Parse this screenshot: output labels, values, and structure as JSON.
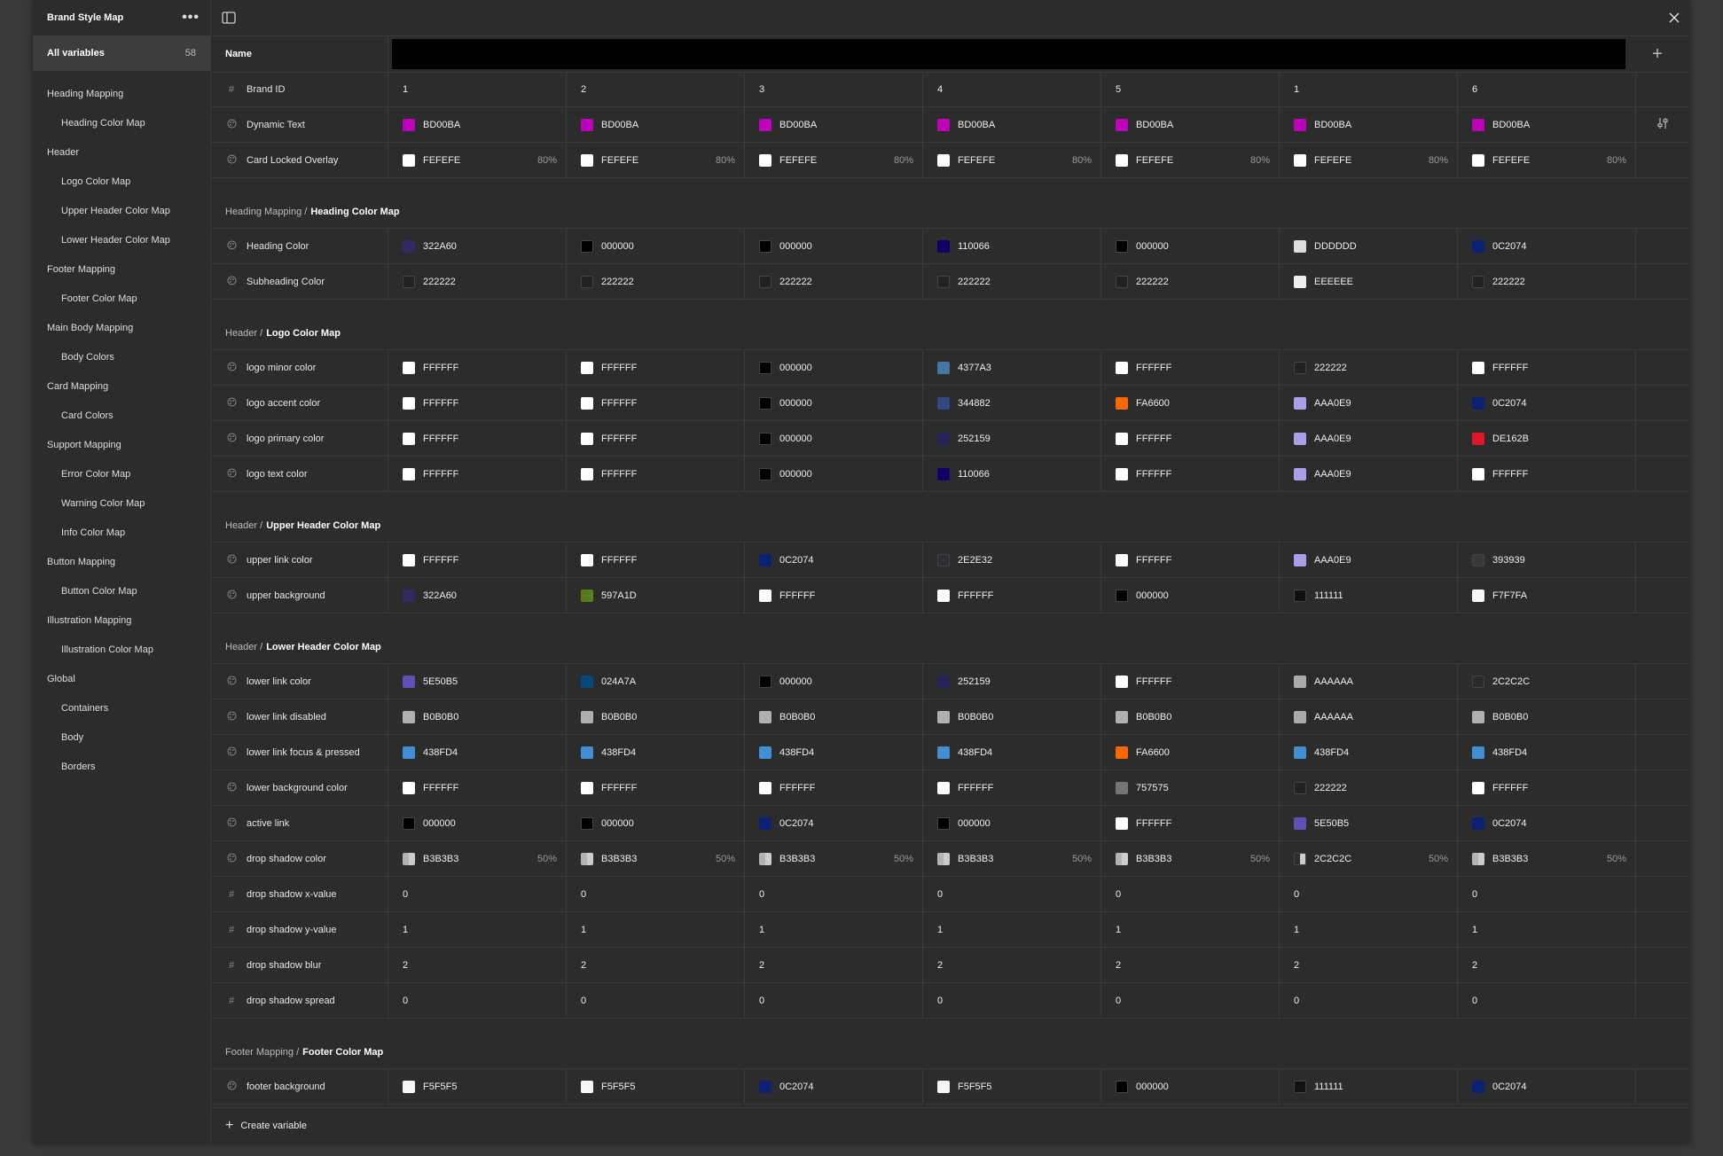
{
  "title": "Brand Style Map",
  "all_variables": {
    "label": "All variables",
    "count": "58"
  },
  "sidebar": [
    {
      "label": "Heading Mapping",
      "child": false
    },
    {
      "label": "Heading Color Map",
      "child": true
    },
    {
      "label": "Header",
      "child": false
    },
    {
      "label": "Logo Color Map",
      "child": true
    },
    {
      "label": "Upper Header Color Map",
      "child": true
    },
    {
      "label": "Lower Header Color Map",
      "child": true
    },
    {
      "label": "Footer Mapping",
      "child": false
    },
    {
      "label": "Footer Color Map",
      "child": true
    },
    {
      "label": "Main Body Mapping",
      "child": false
    },
    {
      "label": "Body Colors",
      "child": true
    },
    {
      "label": "Card Mapping",
      "child": false
    },
    {
      "label": "Card Colors",
      "child": true
    },
    {
      "label": "Support Mapping",
      "child": false
    },
    {
      "label": "Error Color Map",
      "child": true
    },
    {
      "label": "Warning Color Map",
      "child": true
    },
    {
      "label": "Info Color Map",
      "child": true
    },
    {
      "label": "Button Mapping",
      "child": false
    },
    {
      "label": "Button Color Map",
      "child": true
    },
    {
      "label": "Illustration Mapping",
      "child": false
    },
    {
      "label": "Illustration Color Map",
      "child": true
    },
    {
      "label": "Global",
      "child": false
    },
    {
      "label": "Containers",
      "child": true
    },
    {
      "label": "Body",
      "child": true
    },
    {
      "label": "Borders",
      "child": true
    }
  ],
  "name_header": "Name",
  "create_variable": "Create variable",
  "groups": [
    {
      "path": "",
      "name": "",
      "rows": [
        {
          "name": "Brand ID",
          "type": "number",
          "values": [
            "1",
            "2",
            "3",
            "4",
            "5",
            "1",
            "6"
          ]
        },
        {
          "name": "Dynamic Text",
          "type": "color",
          "values": [
            "BD00BA",
            "BD00BA",
            "BD00BA",
            "BD00BA",
            "BD00BA",
            "BD00BA",
            "BD00BA"
          ],
          "tail": true
        },
        {
          "name": "Card Locked Overlay",
          "type": "color",
          "values": [
            "FEFEFE",
            "FEFEFE",
            "FEFEFE",
            "FEFEFE",
            "FEFEFE",
            "FEFEFE",
            "FEFEFE"
          ],
          "alpha": "80%"
        }
      ]
    },
    {
      "path": "Heading Mapping /",
      "name": "Heading Color Map",
      "rows": [
        {
          "name": "Heading Color",
          "type": "color",
          "values": [
            "322A60",
            "000000",
            "000000",
            "110066",
            "000000",
            "DDDDDD",
            "0C2074"
          ]
        },
        {
          "name": "Subheading Color",
          "type": "color",
          "values": [
            "222222",
            "222222",
            "222222",
            "222222",
            "222222",
            "EEEEEE",
            "222222"
          ]
        }
      ]
    },
    {
      "path": "Header /",
      "name": "Logo Color Map",
      "rows": [
        {
          "name": "logo minor color",
          "type": "color",
          "values": [
            "FFFFFF",
            "FFFFFF",
            "000000",
            "4377A3",
            "FFFFFF",
            "222222",
            "FFFFFF"
          ]
        },
        {
          "name": "logo accent color",
          "type": "color",
          "values": [
            "FFFFFF",
            "FFFFFF",
            "000000",
            "344882",
            "FA6600",
            "AAA0E9",
            "0C2074"
          ]
        },
        {
          "name": "logo primary color",
          "type": "color",
          "values": [
            "FFFFFF",
            "FFFFFF",
            "000000",
            "252159",
            "FFFFFF",
            "AAA0E9",
            "DE162B"
          ]
        },
        {
          "name": "logo text color",
          "type": "color",
          "values": [
            "FFFFFF",
            "FFFFFF",
            "000000",
            "110066",
            "FFFFFF",
            "AAA0E9",
            "FFFFFF"
          ]
        }
      ]
    },
    {
      "path": "Header /",
      "name": "Upper Header Color Map",
      "rows": [
        {
          "name": "upper link color",
          "type": "color",
          "values": [
            "FFFFFF",
            "FFFFFF",
            "0C2074",
            "2E2E32",
            "FFFFFF",
            "AAA0E9",
            "393939"
          ]
        },
        {
          "name": "upper background",
          "type": "color",
          "values": [
            "322A60",
            "597A1D",
            "FFFFFF",
            "FFFFFF",
            "000000",
            "111111",
            "F7F7FA"
          ]
        }
      ]
    },
    {
      "path": "Header /",
      "name": "Lower Header Color Map",
      "rows": [
        {
          "name": "lower link color",
          "type": "color",
          "values": [
            "5E50B5",
            "024A7A",
            "000000",
            "252159",
            "FFFFFF",
            "AAAAAA",
            "2C2C2C"
          ]
        },
        {
          "name": "lower link disabled",
          "type": "color",
          "values": [
            "B0B0B0",
            "B0B0B0",
            "B0B0B0",
            "B0B0B0",
            "B0B0B0",
            "AAAAAA",
            "B0B0B0"
          ]
        },
        {
          "name": "lower link focus & pressed",
          "type": "color",
          "values": [
            "438FD4",
            "438FD4",
            "438FD4",
            "438FD4",
            "FA6600",
            "438FD4",
            "438FD4"
          ]
        },
        {
          "name": "lower background color",
          "type": "color",
          "values": [
            "FFFFFF",
            "FFFFFF",
            "FFFFFF",
            "FFFFFF",
            "757575",
            "222222",
            "FFFFFF"
          ]
        },
        {
          "name": "active link",
          "type": "color",
          "values": [
            "000000",
            "000000",
            "0C2074",
            "000000",
            "FFFFFF",
            "5E50B5",
            "0C2074"
          ]
        },
        {
          "name": "drop shadow color",
          "type": "color",
          "values": [
            "B3B3B3",
            "B3B3B3",
            "B3B3B3",
            "B3B3B3",
            "B3B3B3",
            "2C2C2C",
            "B3B3B3"
          ],
          "alpha": "50%"
        },
        {
          "name": "drop shadow x-value",
          "type": "number",
          "values": [
            "0",
            "0",
            "0",
            "0",
            "0",
            "0",
            "0"
          ]
        },
        {
          "name": "drop shadow y-value",
          "type": "number",
          "values": [
            "1",
            "1",
            "1",
            "1",
            "1",
            "1",
            "1"
          ]
        },
        {
          "name": "drop shadow blur",
          "type": "number",
          "values": [
            "2",
            "2",
            "2",
            "2",
            "2",
            "2",
            "2"
          ]
        },
        {
          "name": "drop shadow spread",
          "type": "number",
          "values": [
            "0",
            "0",
            "0",
            "0",
            "0",
            "0",
            "0"
          ]
        }
      ]
    },
    {
      "path": "Footer Mapping /",
      "name": "Footer Color Map",
      "rows": [
        {
          "name": "footer background",
          "type": "color",
          "values": [
            "F5F5F5",
            "F5F5F5",
            "0C2074",
            "F5F5F5",
            "000000",
            "111111",
            "0C2074"
          ]
        }
      ]
    }
  ]
}
